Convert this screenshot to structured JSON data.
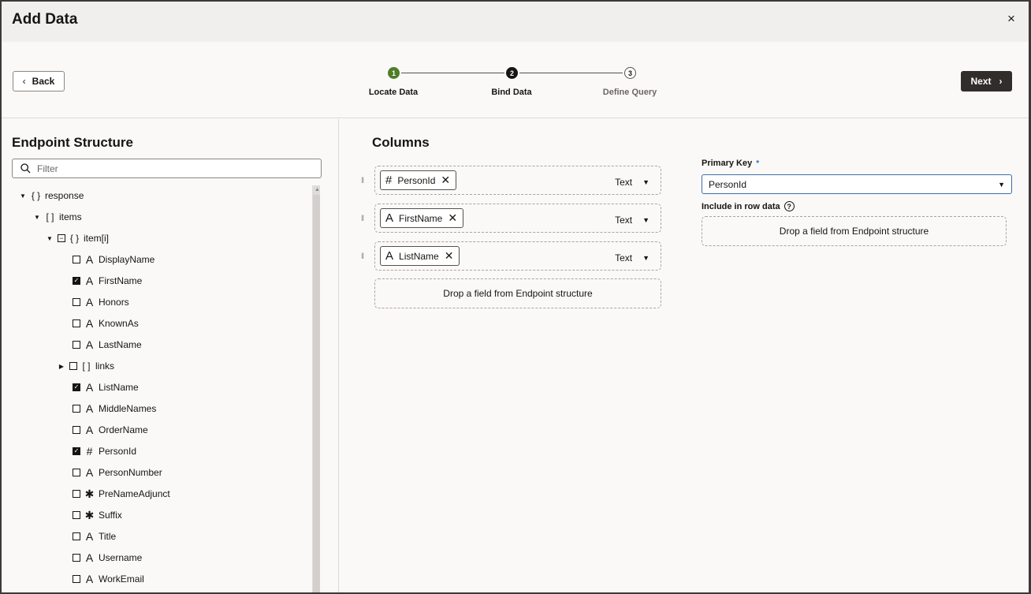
{
  "dialog": {
    "title": "Add Data",
    "close_glyph": "×"
  },
  "nav": {
    "back_label": "Back",
    "next_label": "Next"
  },
  "steps": [
    {
      "num": "1",
      "label": "Locate Data",
      "state": "done",
      "color": "#4f7d28"
    },
    {
      "num": "2",
      "label": "Bind Data",
      "state": "current",
      "color": "#161513"
    },
    {
      "num": "3",
      "label": "Define Query",
      "state": "pending",
      "color": "#ffffff"
    }
  ],
  "endpoint": {
    "title": "Endpoint Structure",
    "filter_placeholder": "Filter",
    "tree": [
      {
        "label": "response",
        "kind": "object",
        "icon": "{ }",
        "expanded": true
      },
      {
        "label": "items",
        "kind": "array",
        "icon": "[ ]",
        "expanded": true
      },
      {
        "label": "item[i]",
        "kind": "object",
        "icon": "{ }",
        "expanded": true
      },
      {
        "label": "DisplayName",
        "type": "text",
        "icon": "A",
        "checked": false
      },
      {
        "label": "FirstName",
        "type": "text",
        "icon": "A",
        "checked": true
      },
      {
        "label": "Honors",
        "type": "text",
        "icon": "A",
        "checked": false
      },
      {
        "label": "KnownAs",
        "type": "text",
        "icon": "A",
        "checked": false
      },
      {
        "label": "LastName",
        "type": "text",
        "icon": "A",
        "checked": false
      },
      {
        "label": "links",
        "type": "array",
        "icon": "[ ]",
        "checked": false,
        "collapsed": true
      },
      {
        "label": "ListName",
        "type": "text",
        "icon": "A",
        "checked": true
      },
      {
        "label": "MiddleNames",
        "type": "text",
        "icon": "A",
        "checked": false
      },
      {
        "label": "OrderName",
        "type": "text",
        "icon": "A",
        "checked": false
      },
      {
        "label": "PersonId",
        "type": "number",
        "icon": "#",
        "checked": true
      },
      {
        "label": "PersonNumber",
        "type": "text",
        "icon": "A",
        "checked": false
      },
      {
        "label": "PreNameAdjunct",
        "type": "any",
        "icon": "✱",
        "checked": false
      },
      {
        "label": "Suffix",
        "type": "any",
        "icon": "✱",
        "checked": false
      },
      {
        "label": "Title",
        "type": "text",
        "icon": "A",
        "checked": false
      },
      {
        "label": "Username",
        "type": "text",
        "icon": "A",
        "checked": false
      },
      {
        "label": "WorkEmail",
        "type": "text",
        "icon": "A",
        "checked": false
      }
    ]
  },
  "columns": {
    "title": "Columns",
    "items": [
      {
        "field": "PersonId",
        "icon": "#",
        "type": "Text"
      },
      {
        "field": "FirstName",
        "icon": "A",
        "type": "Text"
      },
      {
        "field": "ListName",
        "icon": "A",
        "type": "Text"
      }
    ],
    "drop_hint": "Drop a field from Endpoint structure"
  },
  "primary_key": {
    "label": "Primary Key",
    "required_mark": "*",
    "value": "PersonId"
  },
  "row_data": {
    "label": "Include in row data",
    "help_glyph": "?",
    "drop_hint": "Drop a field from Endpoint structure"
  }
}
